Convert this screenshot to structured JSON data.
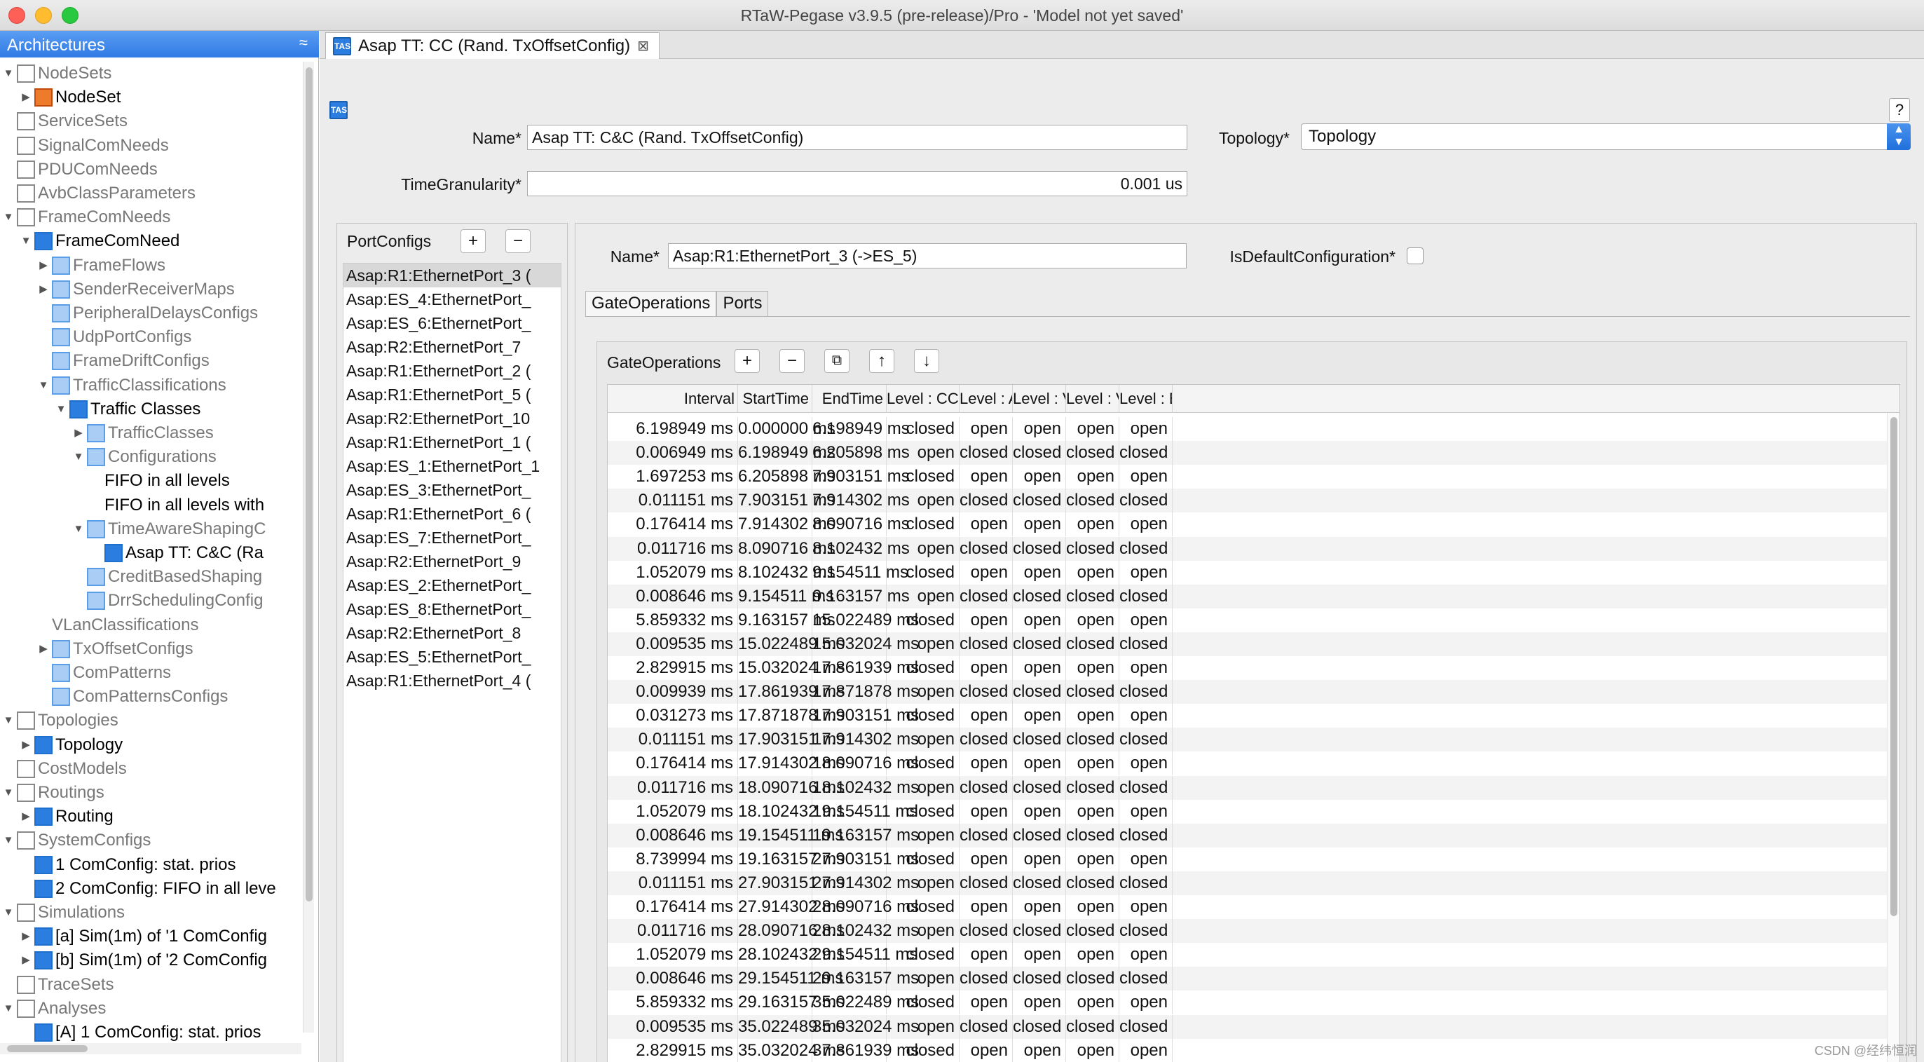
{
  "window": {
    "title": "RTaW-Pegase v3.9.5 (pre-release)/Pro - 'Model not yet saved'"
  },
  "architectures": {
    "header": "Architectures",
    "collapse_glyph": "≈",
    "tree": [
      {
        "label": "NodeSets",
        "depth": 0,
        "toggle": "▼",
        "icon": "grey",
        "style": "grey"
      },
      {
        "label": "NodeSet",
        "depth": 1,
        "toggle": "▶",
        "icon": "orange",
        "style": "bold"
      },
      {
        "label": "ServiceSets",
        "depth": 0,
        "toggle": "",
        "icon": "grey",
        "style": "grey"
      },
      {
        "label": "SignalComNeeds",
        "depth": 0,
        "toggle": "",
        "icon": "grey",
        "style": "grey"
      },
      {
        "label": "PDUComNeeds",
        "depth": 0,
        "toggle": "",
        "icon": "grey",
        "style": "grey"
      },
      {
        "label": "AvbClassParameters",
        "depth": 0,
        "toggle": "",
        "icon": "grey",
        "style": "grey"
      },
      {
        "label": "FrameComNeeds",
        "depth": 0,
        "toggle": "▼",
        "icon": "grey",
        "style": "grey"
      },
      {
        "label": "FrameComNeed",
        "depth": 1,
        "toggle": "▼",
        "icon": "blue",
        "style": "bold"
      },
      {
        "label": "FrameFlows",
        "depth": 2,
        "toggle": "▶",
        "icon": "lblue",
        "style": "grey"
      },
      {
        "label": "SenderReceiverMaps",
        "depth": 2,
        "toggle": "▶",
        "icon": "lblue",
        "style": "grey"
      },
      {
        "label": "PeripheralDelaysConfigs",
        "depth": 2,
        "toggle": "",
        "icon": "lblue",
        "style": "grey"
      },
      {
        "label": "UdpPortConfigs",
        "depth": 2,
        "toggle": "",
        "icon": "lblue",
        "style": "grey"
      },
      {
        "label": "FrameDriftConfigs",
        "depth": 2,
        "toggle": "",
        "icon": "lblue",
        "style": "grey"
      },
      {
        "label": "TrafficClassifications",
        "depth": 2,
        "toggle": "▼",
        "icon": "lblue",
        "style": "grey"
      },
      {
        "label": "Traffic Classes",
        "depth": 3,
        "toggle": "▼",
        "icon": "blue",
        "style": "bold"
      },
      {
        "label": "TrafficClasses",
        "depth": 4,
        "toggle": "▶",
        "icon": "lblue",
        "style": "grey"
      },
      {
        "label": "Configurations",
        "depth": 4,
        "toggle": "▼",
        "icon": "lblue",
        "style": "grey"
      },
      {
        "label": "FIFO in all levels",
        "depth": 5,
        "toggle": "",
        "icon": "none",
        "style": "bold"
      },
      {
        "label": "FIFO in all levels with",
        "depth": 5,
        "toggle": "",
        "icon": "none",
        "style": "bold"
      },
      {
        "label": "TimeAwareShapingC",
        "depth": 4,
        "toggle": "▼",
        "icon": "lblue",
        "style": "grey"
      },
      {
        "label": "Asap TT: C&C (Ra",
        "depth": 5,
        "toggle": "",
        "icon": "blue",
        "style": "bold"
      },
      {
        "label": "CreditBasedShaping",
        "depth": 4,
        "toggle": "",
        "icon": "lblue",
        "style": "grey"
      },
      {
        "label": "DrrSchedulingConfig",
        "depth": 4,
        "toggle": "",
        "icon": "lblue",
        "style": "grey"
      },
      {
        "label": "VLanClassifications",
        "depth": 2,
        "toggle": "",
        "icon": "none",
        "style": "grey"
      },
      {
        "label": "TxOffsetConfigs",
        "depth": 2,
        "toggle": "▶",
        "icon": "lblue",
        "style": "grey"
      },
      {
        "label": "ComPatterns",
        "depth": 2,
        "toggle": "",
        "icon": "lblue",
        "style": "grey"
      },
      {
        "label": "ComPatternsConfigs",
        "depth": 2,
        "toggle": "",
        "icon": "lblue",
        "style": "grey"
      },
      {
        "label": "Topologies",
        "depth": 0,
        "toggle": "▼",
        "icon": "grey",
        "style": "grey"
      },
      {
        "label": "Topology",
        "depth": 1,
        "toggle": "▶",
        "icon": "blue",
        "style": "bold"
      },
      {
        "label": "CostModels",
        "depth": 0,
        "toggle": "",
        "icon": "grey",
        "style": "grey"
      },
      {
        "label": "Routings",
        "depth": 0,
        "toggle": "▼",
        "icon": "grey",
        "style": "grey"
      },
      {
        "label": "Routing",
        "depth": 1,
        "toggle": "▶",
        "icon": "blue",
        "style": "bold"
      },
      {
        "label": "SystemConfigs",
        "depth": 0,
        "toggle": "▼",
        "icon": "grey",
        "style": "grey"
      },
      {
        "label": "1 ComConfig: stat. prios",
        "depth": 1,
        "toggle": "",
        "icon": "blue",
        "style": "bold"
      },
      {
        "label": "2 ComConfig: FIFO in all leve",
        "depth": 1,
        "toggle": "",
        "icon": "blue",
        "style": "bold"
      },
      {
        "label": "Simulations",
        "depth": 0,
        "toggle": "▼",
        "icon": "grey",
        "style": "grey"
      },
      {
        "label": "[a] Sim(1m) of '1 ComConfig",
        "depth": 1,
        "toggle": "▶",
        "icon": "blue",
        "style": "bold"
      },
      {
        "label": "[b] Sim(1m) of '2 ComConfig",
        "depth": 1,
        "toggle": "▶",
        "icon": "blue",
        "style": "bold"
      },
      {
        "label": "TraceSets",
        "depth": 0,
        "toggle": "",
        "icon": "grey",
        "style": "grey"
      },
      {
        "label": "Analyses",
        "depth": 0,
        "toggle": "▼",
        "icon": "grey",
        "style": "grey"
      },
      {
        "label": "[A]  1 ComConfig: stat. prios",
        "depth": 1,
        "toggle": "",
        "icon": "blue",
        "style": "bold"
      }
    ]
  },
  "editor": {
    "tab_label": "Asap TT: CC (Rand. TxOffsetConfig)",
    "tab_close": "⊠",
    "tas_icon_text": "TAS",
    "help_label": "?",
    "name_label": "Name*",
    "name_value": "Asap TT: C&C (Rand. TxOffsetConfig)",
    "topology_label": "Topology*",
    "topology_value": "Topology",
    "time_granularity_label": "TimeGranularity*",
    "time_granularity_value": "0.001 us"
  },
  "port_configs": {
    "title": "PortConfigs",
    "add_label": "+",
    "remove_label": "−",
    "items": [
      "Asap:R1:EthernetPort_3 (",
      "Asap:ES_4:EthernetPort_",
      "Asap:ES_6:EthernetPort_",
      "Asap:R2:EthernetPort_7",
      "Asap:R1:EthernetPort_2 (",
      "Asap:R1:EthernetPort_5 (",
      "Asap:R2:EthernetPort_10",
      "Asap:R1:EthernetPort_1 (",
      "Asap:ES_1:EthernetPort_1",
      "Asap:ES_3:EthernetPort_",
      "Asap:R1:EthernetPort_6 (",
      "Asap:ES_7:EthernetPort_",
      "Asap:R2:EthernetPort_9",
      "Asap:ES_2:EthernetPort_",
      "Asap:ES_8:EthernetPort_",
      "Asap:R2:EthernetPort_8",
      "Asap:ES_5:EthernetPort_",
      "Asap:R1:EthernetPort_4 ("
    ]
  },
  "port_config": {
    "name_label": "Name*",
    "name_value": "Asap:R1:EthernetPort_3 (->ES_5)",
    "is_default_label": "IsDefaultConfiguration*",
    "tabs": [
      "GateOperations",
      "Ports"
    ]
  },
  "gate_operations": {
    "title": "GateOperations",
    "btn_add": "+",
    "btn_remove": "−",
    "btn_copy": "⧉",
    "btn_up": "↑",
    "btn_down": "↓",
    "columns": [
      "Interval",
      "StartTime",
      "EndTime",
      "Level : CC",
      "Level : Audio",
      "Level : Video",
      "Level : Video",
      "Level : BE"
    ],
    "rows": [
      [
        "6.198949 ms",
        "0.000000 ms",
        "6.198949 ms",
        "closed",
        "open",
        "open",
        "open",
        "open"
      ],
      [
        "0.006949 ms",
        "6.198949 ms",
        "6.205898 ms",
        "open",
        "closed",
        "closed",
        "closed",
        "closed"
      ],
      [
        "1.697253 ms",
        "6.205898 ms",
        "7.903151 ms",
        "closed",
        "open",
        "open",
        "open",
        "open"
      ],
      [
        "0.011151 ms",
        "7.903151 ms",
        "7.914302 ms",
        "open",
        "closed",
        "closed",
        "closed",
        "closed"
      ],
      [
        "0.176414 ms",
        "7.914302 ms",
        "8.090716 ms",
        "closed",
        "open",
        "open",
        "open",
        "open"
      ],
      [
        "0.011716 ms",
        "8.090716 ms",
        "8.102432 ms",
        "open",
        "closed",
        "closed",
        "closed",
        "closed"
      ],
      [
        "1.052079 ms",
        "8.102432 ms",
        "9.154511 ms",
        "closed",
        "open",
        "open",
        "open",
        "open"
      ],
      [
        "0.008646 ms",
        "9.154511 ms",
        "9.163157 ms",
        "open",
        "closed",
        "closed",
        "closed",
        "closed"
      ],
      [
        "5.859332 ms",
        "9.163157 ms",
        "15.022489 ms",
        "closed",
        "open",
        "open",
        "open",
        "open"
      ],
      [
        "0.009535 ms",
        "15.022489 ms",
        "15.032024 ms",
        "open",
        "closed",
        "closed",
        "closed",
        "closed"
      ],
      [
        "2.829915 ms",
        "15.032024 ms",
        "17.861939 ms",
        "closed",
        "open",
        "open",
        "open",
        "open"
      ],
      [
        "0.009939 ms",
        "17.861939 ms",
        "17.871878 ms",
        "open",
        "closed",
        "closed",
        "closed",
        "closed"
      ],
      [
        "0.031273 ms",
        "17.871878 ms",
        "17.903151 ms",
        "closed",
        "open",
        "open",
        "open",
        "open"
      ],
      [
        "0.011151 ms",
        "17.903151 ms",
        "17.914302 ms",
        "open",
        "closed",
        "closed",
        "closed",
        "closed"
      ],
      [
        "0.176414 ms",
        "17.914302 ms",
        "18.090716 ms",
        "closed",
        "open",
        "open",
        "open",
        "open"
      ],
      [
        "0.011716 ms",
        "18.090716 ms",
        "18.102432 ms",
        "open",
        "closed",
        "closed",
        "closed",
        "closed"
      ],
      [
        "1.052079 ms",
        "18.102432 ms",
        "19.154511 ms",
        "closed",
        "open",
        "open",
        "open",
        "open"
      ],
      [
        "0.008646 ms",
        "19.154511 ms",
        "19.163157 ms",
        "open",
        "closed",
        "closed",
        "closed",
        "closed"
      ],
      [
        "8.739994 ms",
        "19.163157 ms",
        "27.903151 ms",
        "closed",
        "open",
        "open",
        "open",
        "open"
      ],
      [
        "0.011151 ms",
        "27.903151 ms",
        "27.914302 ms",
        "open",
        "closed",
        "closed",
        "closed",
        "closed"
      ],
      [
        "0.176414 ms",
        "27.914302 ms",
        "28.090716 ms",
        "closed",
        "open",
        "open",
        "open",
        "open"
      ],
      [
        "0.011716 ms",
        "28.090716 ms",
        "28.102432 ms",
        "open",
        "closed",
        "closed",
        "closed",
        "closed"
      ],
      [
        "1.052079 ms",
        "28.102432 ms",
        "29.154511 ms",
        "closed",
        "open",
        "open",
        "open",
        "open"
      ],
      [
        "0.008646 ms",
        "29.154511 ms",
        "29.163157 ms",
        "open",
        "closed",
        "closed",
        "closed",
        "closed"
      ],
      [
        "5.859332 ms",
        "29.163157 ms",
        "35.022489 ms",
        "closed",
        "open",
        "open",
        "open",
        "open"
      ],
      [
        "0.009535 ms",
        "35.022489 ms",
        "35.032024 ms",
        "open",
        "closed",
        "closed",
        "closed",
        "closed"
      ],
      [
        "2.829915 ms",
        "35.032024 ms",
        "37.861939 ms",
        "closed",
        "open",
        "open",
        "open",
        "open"
      ]
    ]
  },
  "watermark": "CSDN @经纬恒润",
  "colors": {
    "accent": "#2f7ae5",
    "selection": "#d8d8d8"
  }
}
